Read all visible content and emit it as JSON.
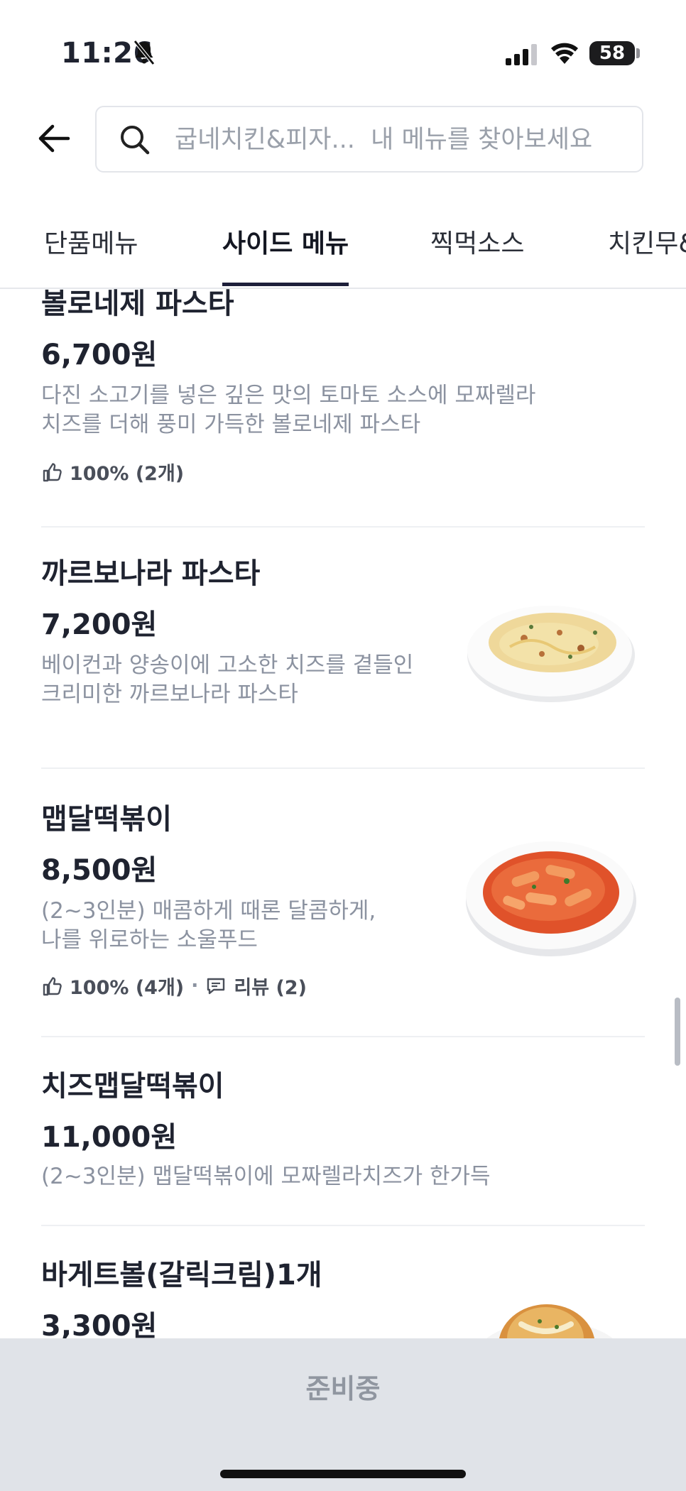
{
  "status_bar": {
    "time": "11:26",
    "battery": "58"
  },
  "header": {
    "search_placeholder": "굽네치킨&피자...  내 메뉴를 찾아보세요"
  },
  "tabs": [
    {
      "label": "단품메뉴",
      "active": false
    },
    {
      "label": "사이드 메뉴",
      "active": true
    },
    {
      "label": "찍먹소스",
      "active": false
    },
    {
      "label": "치킨무&",
      "active": false
    }
  ],
  "menu_items": [
    {
      "name": "볼로네제 파스타",
      "price": "6,700원",
      "desc_line1": "다진 소고기를 넣은 깊은 맛의 토마토 소스에 모짜렐라",
      "desc_line2": "치즈를 더해 풍미 가득한 볼로네제 파스타",
      "rating": "100% (2개)"
    },
    {
      "name": "까르보나라 파스타",
      "price": "7,200원",
      "desc_line1": "베이컨과 양송이에 고소한 치즈를 곁들인",
      "desc_line2": "크리미한 까르보나라 파스타",
      "image": "carbonara-pasta-icon"
    },
    {
      "name": "맵달떡볶이",
      "price": "8,500원",
      "desc_line1": "(2~3인분) 매콤하게 때론 달콤하게,",
      "desc_line2": "나를 위로하는 소울푸드",
      "rating": "100% (4개)",
      "separator": "·",
      "reviews": "리뷰 (2)",
      "image": "tteokbokki-icon"
    },
    {
      "name": "치즈맵달떡볶이",
      "price": "11,000원",
      "desc_line1": "(2~3인분) 맵달떡볶이에 모짜렐라치즈가 한가득"
    },
    {
      "name": "바게트볼(갈릭크림)1개",
      "price": "3,300원",
      "image": "garlic-bread-icon"
    }
  ],
  "bottom_bar": {
    "status_label": "준비중"
  },
  "colors": {
    "accent": "#1d1f3a",
    "muted_text": "#8b92a0",
    "bottom_bg": "#e0e3e8"
  }
}
